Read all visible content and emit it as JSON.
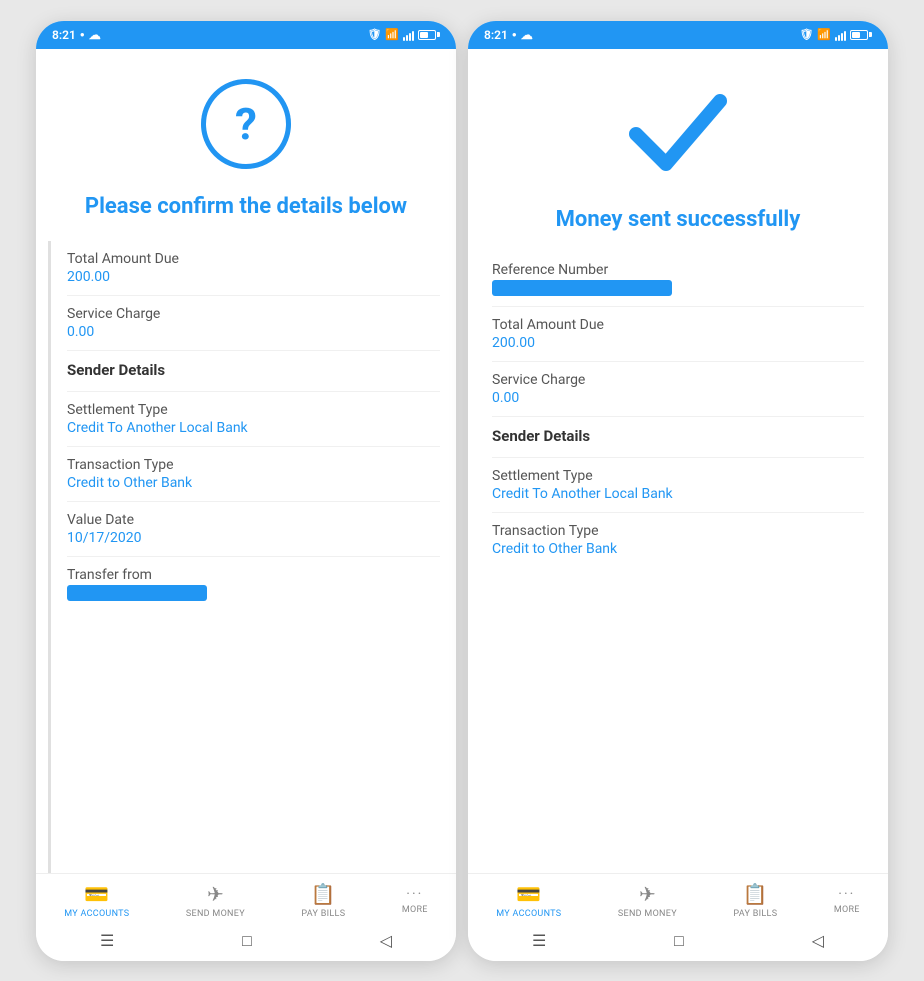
{
  "phone1": {
    "statusBar": {
      "time": "8:21",
      "leftIcons": [
        "dot",
        "cloud"
      ],
      "rightIcons": [
        "shield",
        "wifi",
        "signal",
        "battery"
      ]
    },
    "confirmTitle": "Please confirm the details below",
    "fields": [
      {
        "label": "Total Amount Due",
        "value": "200.00",
        "type": "value"
      },
      {
        "label": "Service Charge",
        "value": "0.00",
        "type": "value"
      },
      {
        "label": "Sender Details",
        "value": "",
        "type": "header"
      },
      {
        "label": "Settlement Type",
        "value": "Credit To Another Local Bank",
        "type": "value"
      },
      {
        "label": "Transaction Type",
        "value": "Credit to Other Bank",
        "type": "value"
      },
      {
        "label": "Value Date",
        "value": "10/17/2020",
        "type": "value"
      },
      {
        "label": "Transfer from",
        "value": "",
        "type": "redacted"
      }
    ],
    "bottomNav": [
      {
        "icon": "💳",
        "label": "MY ACCOUNTS",
        "active": true
      },
      {
        "icon": "✈",
        "label": "SEND MONEY",
        "active": false
      },
      {
        "icon": "📄",
        "label": "PAY BILLS",
        "active": false
      },
      {
        "icon": "···",
        "label": "MORE",
        "active": false
      }
    ]
  },
  "phone2": {
    "statusBar": {
      "time": "8:21",
      "leftIcons": [
        "dot",
        "cloud"
      ],
      "rightIcons": [
        "shield",
        "wifi",
        "signal",
        "battery"
      ]
    },
    "successTitle": "Money sent successfully",
    "fields": [
      {
        "label": "Reference Number",
        "value": "",
        "type": "redacted"
      },
      {
        "label": "Total Amount Due",
        "value": "200.00",
        "type": "value"
      },
      {
        "label": "Service Charge",
        "value": "0.00",
        "type": "value"
      },
      {
        "label": "Sender Details",
        "value": "",
        "type": "header"
      },
      {
        "label": "Settlement Type",
        "value": "Credit To Another Local Bank",
        "type": "value"
      },
      {
        "label": "Transaction Type",
        "value": "Credit to Other Bank",
        "type": "value"
      }
    ],
    "bottomNav": [
      {
        "icon": "💳",
        "label": "MY ACCOUNTS",
        "active": true
      },
      {
        "icon": "✈",
        "label": "SEND MONEY",
        "active": false
      },
      {
        "icon": "📄",
        "label": "PAY BILLS",
        "active": false
      },
      {
        "icon": "···",
        "label": "MORE",
        "active": false
      }
    ]
  }
}
